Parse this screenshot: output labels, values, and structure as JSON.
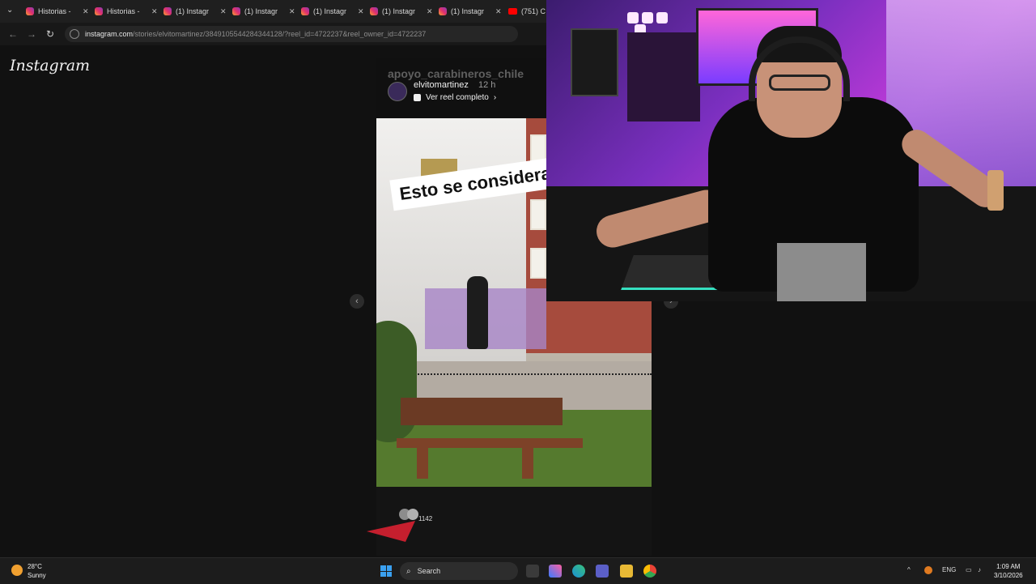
{
  "browser": {
    "tabs": [
      {
        "label": "Historias -",
        "icon": "instagram-icon"
      },
      {
        "label": "Historias -",
        "icon": "instagram-icon"
      },
      {
        "label": "(1) Instagr",
        "icon": "instagram-icon"
      },
      {
        "label": "(1) Instagr",
        "icon": "instagram-icon"
      },
      {
        "label": "(1) Instagr",
        "icon": "instagram-icon"
      },
      {
        "label": "(1) Instagr",
        "icon": "instagram-icon"
      },
      {
        "label": "(1) Instagr",
        "icon": "instagram-icon"
      },
      {
        "label": "(751) Ca",
        "icon": "youtube-icon"
      }
    ],
    "url_host": "instagram.com",
    "url_path": "/stories/elvitomartinez/3849105544284344128/?reel_id=4722237&reel_owner_id=4722237"
  },
  "instagram": {
    "logo": "Instagram",
    "story": {
      "repost_name": "apoyo_carabineros_chile",
      "username": "elvitomartinez",
      "time": "12 h",
      "reel_link": "Ver reel completo",
      "caption": "Esto se considera",
      "viewer_count": "1142"
    }
  },
  "taskbar": {
    "temperature": "28°C",
    "condition": "Sunny",
    "search_placeholder": "Search",
    "language": "ENG",
    "time": "1:09 AM",
    "date": "3/10/2026"
  }
}
